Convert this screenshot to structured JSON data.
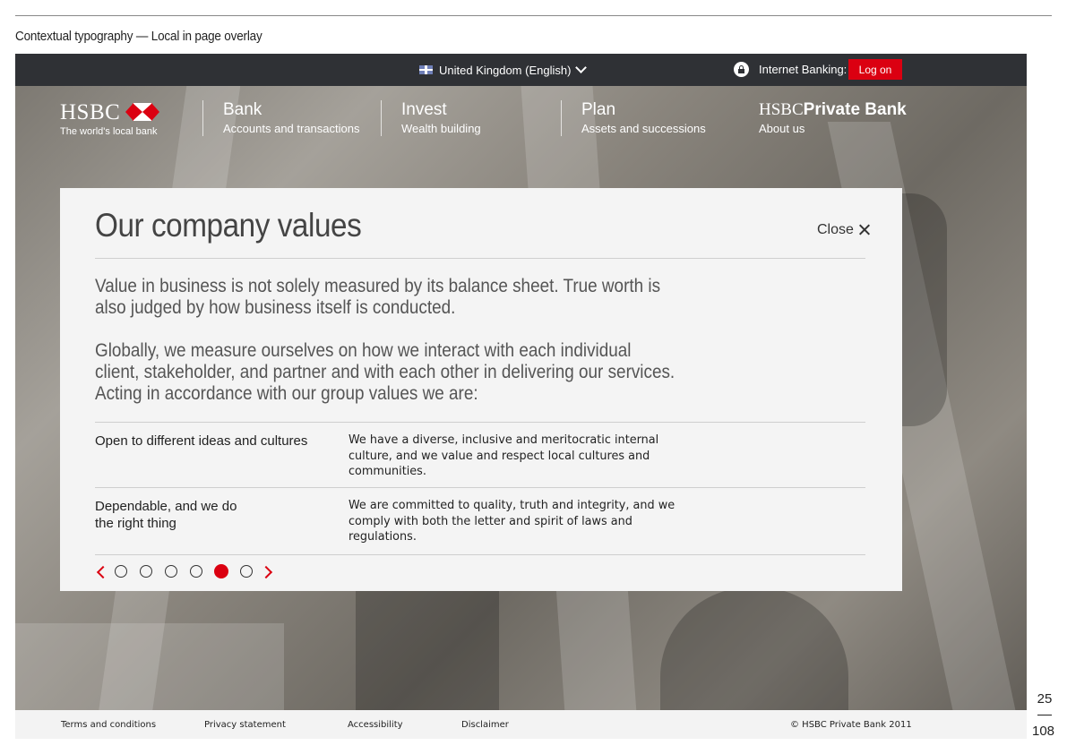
{
  "document": {
    "caption": "Contextual typography — Local in page overlay",
    "page_number": "25",
    "page_total": "108"
  },
  "utility_bar": {
    "country": "United Kingdom (English)",
    "internet_banking_label": "Internet Banking:",
    "login_label": "Log on",
    "colors": {
      "bar": "#2f3135",
      "login": "#db0011"
    }
  },
  "header": {
    "logo_text": "HSBC",
    "tagline": "The world's local bank",
    "nav": [
      {
        "title": "Bank",
        "subtitle": "Accounts and transactions"
      },
      {
        "title": "Invest",
        "subtitle": "Wealth building"
      },
      {
        "title": "Plan",
        "subtitle": "Assets and successions"
      }
    ],
    "private_bank": {
      "brand_serif": "HSBC",
      "brand_bold": "Private Bank",
      "subtitle": "About us"
    }
  },
  "overlay": {
    "title": "Our company values",
    "close_label": "Close",
    "paragraphs": [
      "Value in business is not solely measured by its balance sheet. True worth is also judged by how business itself is conducted.",
      "Globally, we measure ourselves on how we interact with each individual client, stakeholder, and partner and with each other in delivering our services. Acting in accordance with our group values we are:"
    ],
    "values": [
      {
        "title": "Open to different ideas and cultures",
        "description": "We have a diverse, inclusive and meritocratic internal culture, and we value and respect local cultures and communities."
      },
      {
        "title": "Dependable, and we do the right thing",
        "description": "We are committed to quality, truth and integrity, and we comply with both the letter and spirit of laws and regulations."
      }
    ],
    "pager": {
      "total": 6,
      "active": 5
    }
  },
  "footer": {
    "links": [
      "Terms and conditions",
      "Privacy statement",
      "Accessibility",
      "Disclaimer"
    ],
    "copyright": "© HSBC Private Bank 2011"
  }
}
